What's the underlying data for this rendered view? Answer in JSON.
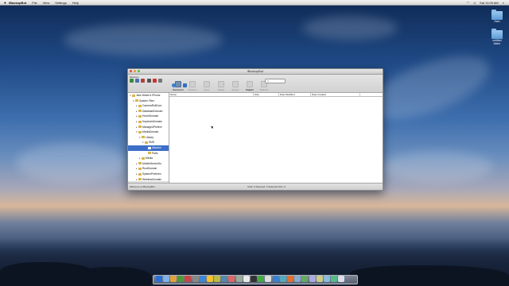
{
  "menubar": {
    "apple": "",
    "app_name": "iBackupBot",
    "items": [
      "File",
      "View",
      "Settings",
      "Help"
    ],
    "clock": "Sat 11:05 AM"
  },
  "desktop_icons": [
    {
      "label": "Sam"
    },
    {
      "label": "untitled folder"
    }
  ],
  "window": {
    "title": "iBackupBot",
    "left_panel_label": "Backups",
    "toolbar": [
      {
        "label": "Backward",
        "state": "active"
      },
      {
        "label": "Restore",
        "state": "disabled"
      },
      {
        "label": "Open",
        "state": "disabled"
      },
      {
        "label": "Delete",
        "state": "disabled"
      },
      {
        "label": "Export",
        "state": "disabled"
      },
      {
        "label": "Import",
        "state": "bold"
      },
      {
        "label": "Refresh",
        "state": "disabled"
      }
    ],
    "search_placeholder": "Q",
    "tree": [
      {
        "label": "Jack Wolen's iPhone",
        "indent": 0,
        "arrow": "▾"
      },
      {
        "label": "System Files",
        "indent": 1,
        "arrow": "▾"
      },
      {
        "label": "CameraRollDom",
        "indent": 2,
        "arrow": "▸"
      },
      {
        "label": "DatabaseDomain",
        "indent": 2,
        "arrow": "▸"
      },
      {
        "label": "HomeDomain",
        "indent": 2,
        "arrow": "▸"
      },
      {
        "label": "KeychainDomain",
        "indent": 2,
        "arrow": "▸"
      },
      {
        "label": "ManagedPrefere",
        "indent": 2,
        "arrow": "▸"
      },
      {
        "label": "MediaDomain",
        "indent": 2,
        "arrow": "▾"
      },
      {
        "label": "Library",
        "indent": 3,
        "arrow": "▾"
      },
      {
        "label": "SMS",
        "indent": 4,
        "arrow": "▾"
      },
      {
        "label": "Attachm",
        "indent": 5,
        "arrow": "",
        "selected": true
      },
      {
        "label": "Parts",
        "indent": 5,
        "arrow": ""
      },
      {
        "label": "Media",
        "indent": 3,
        "arrow": "▸"
      },
      {
        "label": "MobileDeviceDo",
        "indent": 2,
        "arrow": "▸"
      },
      {
        "label": "RootDomain",
        "indent": 2,
        "arrow": "▸"
      },
      {
        "label": "SystemPreferen",
        "indent": 2,
        "arrow": "▸"
      },
      {
        "label": "WirelessDomain",
        "indent": 2,
        "arrow": "▸"
      }
    ],
    "columns": [
      "Name",
      "Size",
      "Date Modified",
      "Date Created"
    ],
    "status_left": "Welcome to iBackupBot",
    "status_center": "Total: 0 Selected: 0 Selected Size: 0"
  },
  "dock_colors": [
    "#2a6fd6",
    "#7fb2e8",
    "#e3a13b",
    "#4c9a3b",
    "#c44",
    "#888",
    "#3c87d6",
    "#f2c230",
    "#bb4",
    "#58a",
    "#d66",
    "#9a9",
    "#e8e8e8",
    "#333",
    "#4a4",
    "#ddd",
    "#3b7fd1",
    "#5ab",
    "#e07030",
    "#8ac",
    "#6a6",
    "#aad",
    "#cc8",
    "#8bd",
    "#5b8",
    "#dde"
  ]
}
